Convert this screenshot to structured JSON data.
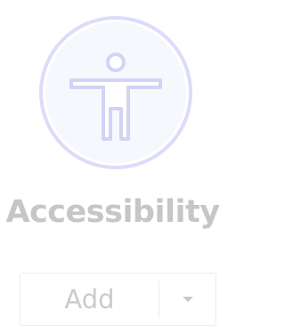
{
  "app": {
    "title": "Accessibility",
    "icon": "accessibility-icon",
    "accent_color": "#dcdcfa"
  },
  "actions": {
    "add_label": "Add",
    "menu_icon": "chevron-down-icon"
  }
}
